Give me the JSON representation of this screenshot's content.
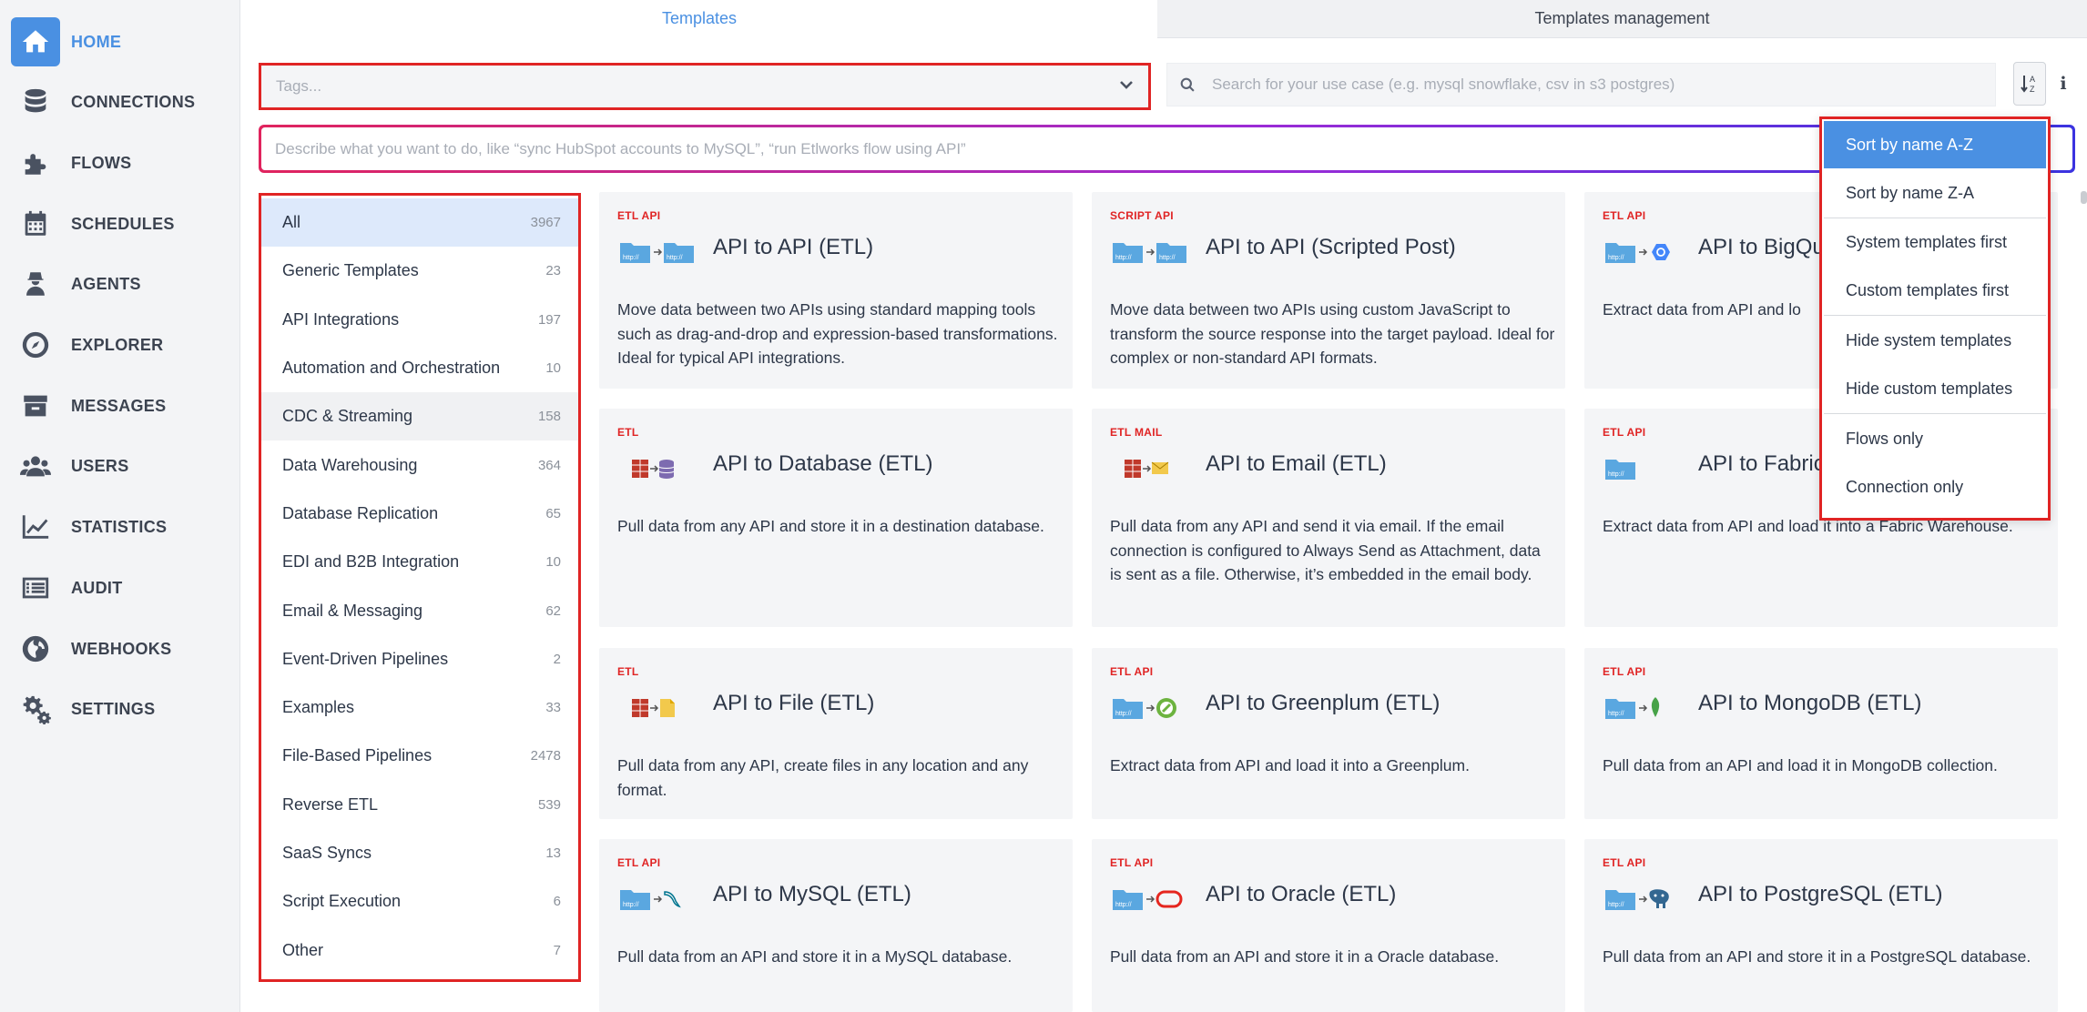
{
  "sidebar": {
    "items": [
      {
        "label": "HOME",
        "icon": "home-icon"
      },
      {
        "label": "CONNECTIONS",
        "icon": "database-icon"
      },
      {
        "label": "FLOWS",
        "icon": "puzzle-icon"
      },
      {
        "label": "SCHEDULES",
        "icon": "calendar-icon"
      },
      {
        "label": "AGENTS",
        "icon": "agent-icon"
      },
      {
        "label": "EXPLORER",
        "icon": "compass-icon"
      },
      {
        "label": "MESSAGES",
        "icon": "inbox-icon"
      },
      {
        "label": "USERS",
        "icon": "users-icon"
      },
      {
        "label": "STATISTICS",
        "icon": "chart-line-icon"
      },
      {
        "label": "AUDIT",
        "icon": "list-icon"
      },
      {
        "label": "WEBHOOKS",
        "icon": "globe-icon"
      },
      {
        "label": "SETTINGS",
        "icon": "gears-icon"
      }
    ]
  },
  "tabs": [
    "Templates",
    "Templates management"
  ],
  "filters": {
    "tags_placeholder": "Tags...",
    "search_placeholder": "Search for your use case (e.g. mysql snowflake, csv in s3 postgres)",
    "describe_placeholder": "Describe what you want to do, like “sync HubSpot accounts to MySQL”, “run Etlworks flow using API”",
    "info_label": "i"
  },
  "categories": [
    {
      "label": "All",
      "count": "3967"
    },
    {
      "label": "Generic Templates",
      "count": "23"
    },
    {
      "label": "API Integrations",
      "count": "197"
    },
    {
      "label": "Automation and Orchestration",
      "count": "10"
    },
    {
      "label": "CDC & Streaming",
      "count": "158"
    },
    {
      "label": "Data Warehousing",
      "count": "364"
    },
    {
      "label": "Database Replication",
      "count": "65"
    },
    {
      "label": "EDI and B2B Integration",
      "count": "10"
    },
    {
      "label": "Email & Messaging",
      "count": "62"
    },
    {
      "label": "Event-Driven Pipelines",
      "count": "2"
    },
    {
      "label": "Examples",
      "count": "33"
    },
    {
      "label": "File-Based Pipelines",
      "count": "2478"
    },
    {
      "label": "Reverse ETL",
      "count": "539"
    },
    {
      "label": "SaaS Syncs",
      "count": "13"
    },
    {
      "label": "Script Execution",
      "count": "6"
    },
    {
      "label": "Other",
      "count": "7"
    }
  ],
  "cards": [
    {
      "tag": "ETL API",
      "title": "API to API (ETL)",
      "desc": "Move data between two APIs using standard mapping tools such as drag-and-drop and expression-based transformations. Ideal for typical API integrations.",
      "icon": "api-to-api-icon"
    },
    {
      "tag": "SCRIPT API",
      "title": "API to API (Scripted Post)",
      "desc": "Move data between two APIs using custom JavaScript to transform the source response into the target payload. Ideal for complex or non-standard API formats.",
      "icon": "api-to-api-icon"
    },
    {
      "tag": "ETL API",
      "title": "API to BigQu",
      "desc": "Extract data from API and lo",
      "icon": "api-to-bigquery-icon"
    },
    {
      "tag": "ETL",
      "title": "API to Database (ETL)",
      "desc": "Pull data from any API and store it in a destination database.",
      "icon": "api-to-database-icon"
    },
    {
      "tag": "ETL MAIL",
      "title": "API to Email (ETL)",
      "desc": "Pull data from any API and send it via email. If the email connection is configured to Always Send as Attachment, data is sent as a file. Otherwise, it’s embedded in the email body.",
      "icon": "api-to-email-icon"
    },
    {
      "tag": "ETL API",
      "title": "API to Fabric",
      "desc": "Extract data from API and load it into a Fabric Warehouse.",
      "icon": "api-to-fabric-icon"
    },
    {
      "tag": "ETL",
      "title": "API to File (ETL)",
      "desc": "Pull data from any API, create files in any location and any format.",
      "icon": "api-to-file-icon"
    },
    {
      "tag": "ETL API",
      "title": "API to Greenplum (ETL)",
      "desc": "Extract data from API and load it into a Greenplum.",
      "icon": "api-to-greenplum-icon"
    },
    {
      "tag": "ETL API",
      "title": "API to MongoDB (ETL)",
      "desc": "Pull data from an API and load it in MongoDB collection.",
      "icon": "api-to-mongodb-icon"
    },
    {
      "tag": "ETL API",
      "title": "API to MySQL (ETL)",
      "desc": "Pull data from an API and store it in a MySQL database.",
      "icon": "api-to-mysql-icon"
    },
    {
      "tag": "ETL API",
      "title": "API to Oracle (ETL)",
      "desc": "Pull data from an API and store it in a Oracle database.",
      "icon": "api-to-oracle-icon"
    },
    {
      "tag": "ETL API",
      "title": "API to PostgreSQL (ETL)",
      "desc": "Pull data from an API and store it in a PostgreSQL database.",
      "icon": "api-to-postgresql-icon"
    }
  ],
  "sort_menu": {
    "items": [
      "Sort by name A-Z",
      "Sort by name Z-A",
      "System templates first",
      "Custom templates first",
      "Hide system templates",
      "Hide custom templates",
      "Flows only",
      "Connection only"
    ],
    "selected": "Sort by name A-Z"
  },
  "colors": {
    "accent": "#4a90e2",
    "tag_red": "#e02424",
    "highlight_border": "#e02424",
    "selected_category_bg": "#dde9fb"
  }
}
